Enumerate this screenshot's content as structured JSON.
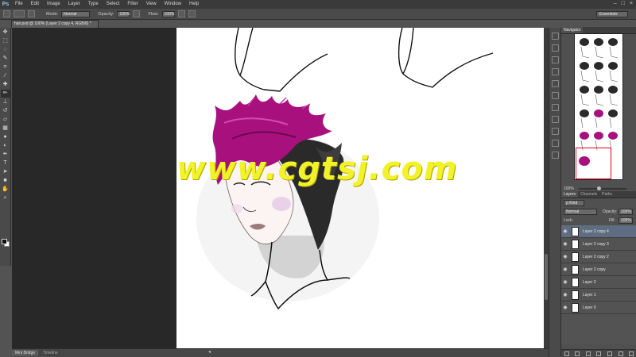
{
  "app": {
    "logo": "Ps",
    "menu": [
      "File",
      "Edit",
      "Image",
      "Layer",
      "Type",
      "Select",
      "Filter",
      "View",
      "Window",
      "Help"
    ],
    "window_controls": [
      "–",
      "□",
      "×"
    ]
  },
  "options_bar": {
    "mode_label": "Mode:",
    "mode_value": "Normal",
    "opacity_label": "Opacity:",
    "opacity_value": "100%",
    "flow_label": "Flow:",
    "flow_value": "100%",
    "workspace": "Essentials"
  },
  "document": {
    "tab_title": "hair.psd @ 100% (Layer 2 copy 4, RGB/8) *"
  },
  "watermark": "www.cgtsj.com",
  "bottom_tabs": [
    "Mini Bridge",
    "Timeline"
  ],
  "navigator": {
    "tab": "Navigator",
    "zoom": "100%"
  },
  "layers_panel": {
    "tabs": [
      "Layers",
      "Channels",
      "Paths"
    ],
    "kind_label": "ρ Kind",
    "blend_mode": "Normal",
    "opacity_label": "Opacity:",
    "opacity_value": "100%",
    "lock_label": "Lock:",
    "fill_label": "Fill:",
    "fill_value": "100%",
    "layers": [
      {
        "name": "Layer 2 copy 4",
        "selected": true
      },
      {
        "name": "Layer 2 copy 3",
        "selected": false
      },
      {
        "name": "Layer 2 copy 2",
        "selected": false
      },
      {
        "name": "Layer 2 copy",
        "selected": false
      },
      {
        "name": "Layer 2",
        "selected": false
      },
      {
        "name": "Layer 1",
        "selected": false
      },
      {
        "name": "Layer 0",
        "selected": false
      }
    ]
  },
  "colors": {
    "hair_accent": "#a8107e",
    "selection_highlight": "#5f6d80",
    "watermark": "#f2f228",
    "navigator_proxy": "#e4001c"
  },
  "icons": {
    "tools": [
      "move-icon",
      "marquee-icon",
      "lasso-icon",
      "quick-select-icon",
      "crop-icon",
      "eyedropper-icon",
      "healing-icon",
      "brush-icon",
      "clone-stamp-icon",
      "history-brush-icon",
      "eraser-icon",
      "gradient-icon",
      "blur-icon",
      "dodge-icon",
      "pen-icon",
      "type-icon",
      "path-select-icon",
      "shape-icon",
      "hand-icon",
      "zoom-icon"
    ]
  }
}
